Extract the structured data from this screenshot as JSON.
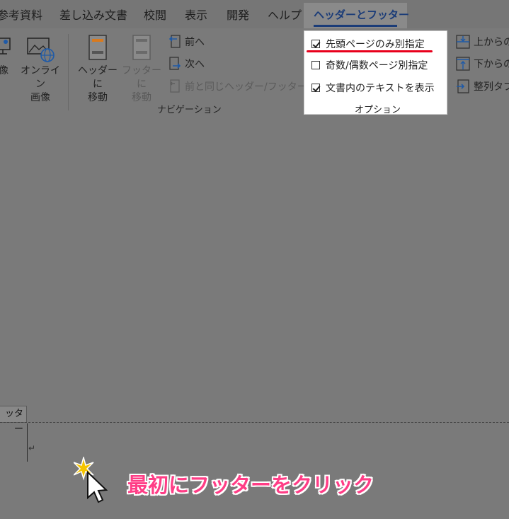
{
  "tabs": {
    "references": "参考資料",
    "mailings": "差し込み文書",
    "review": "校閲",
    "view": "表示",
    "developer": "開発",
    "help": "ヘルプ",
    "header_footer": "ヘッダーとフッター"
  },
  "ribbon": {
    "insert": {
      "image_partial": "像",
      "online_image_line1": "オンライン",
      "online_image_line2": "画像"
    },
    "navigation": {
      "goto_header_line1": "ヘッダーに",
      "goto_header_line2": "移動",
      "goto_footer_line1": "フッターに",
      "goto_footer_line2": "移動",
      "previous": "前へ",
      "next": "次へ",
      "link_to_previous": "前と同じヘッダー/フッター",
      "group_label": "ナビゲーション"
    },
    "options": {
      "different_first_page": "先頭ページのみ別指定",
      "different_odd_even": "奇数/偶数ページ別指定",
      "show_document_text": "文書内のテキストを表示",
      "group_label": "オプション",
      "different_first_page_checked": true,
      "different_odd_even_checked": false,
      "show_document_text_checked": true
    },
    "position": {
      "header_from_top": "上からの",
      "footer_from_bottom": "下からの",
      "insert_alignment_tab": "整列タブ"
    }
  },
  "document": {
    "footer_tag": "ッター",
    "paragraph_mark": "↵"
  },
  "annotation": "最初にフッターをクリック",
  "colors": {
    "accent": "#1b3c78",
    "highlight_red": "#e8001c",
    "annotation_pink": "#ff3d86"
  }
}
